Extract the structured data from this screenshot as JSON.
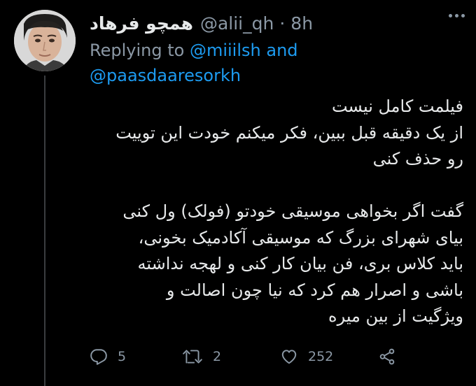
{
  "user": {
    "display_name": "همچو فرهاد",
    "handle": "@alii_qh",
    "separator": "·",
    "time": "8h"
  },
  "replying": {
    "prefix": "Replying to",
    "mention_1": "@miiilsh",
    "conjunction": "and",
    "mention_2": "@paasdaaresorkh"
  },
  "body": {
    "lines": [
      "فیلمت کامل نیست",
      "از یک دقیقه قبل ببین، فکر میکنم خودت این توییت",
      "رو حذف کنی",
      "",
      "گفت اگر بخواهی موسیقی خودتو  (فولک) ول کنی",
      "بیای شهرای بزرگ که موسیقی آکادمیک بخونی،",
      "باید کلاس بری، فن بیان کار کنی و لهجه نداشته",
      "باشی  و اصرار هم کرد که نیا چون اصالت و",
      "ویژگیت از بین میره"
    ]
  },
  "actions": {
    "reply": {
      "icon": "reply-icon",
      "count": "5"
    },
    "retweet": {
      "icon": "retweet-icon",
      "count": "2"
    },
    "like": {
      "icon": "heart-icon",
      "count": "252"
    },
    "share": {
      "icon": "share-icon"
    }
  },
  "colors": {
    "background": "#000000",
    "primary_text": "#e7e9ea",
    "secondary_text": "#8b98a5",
    "accent": "#1d9bf0",
    "thread_line": "#3a3d40"
  }
}
